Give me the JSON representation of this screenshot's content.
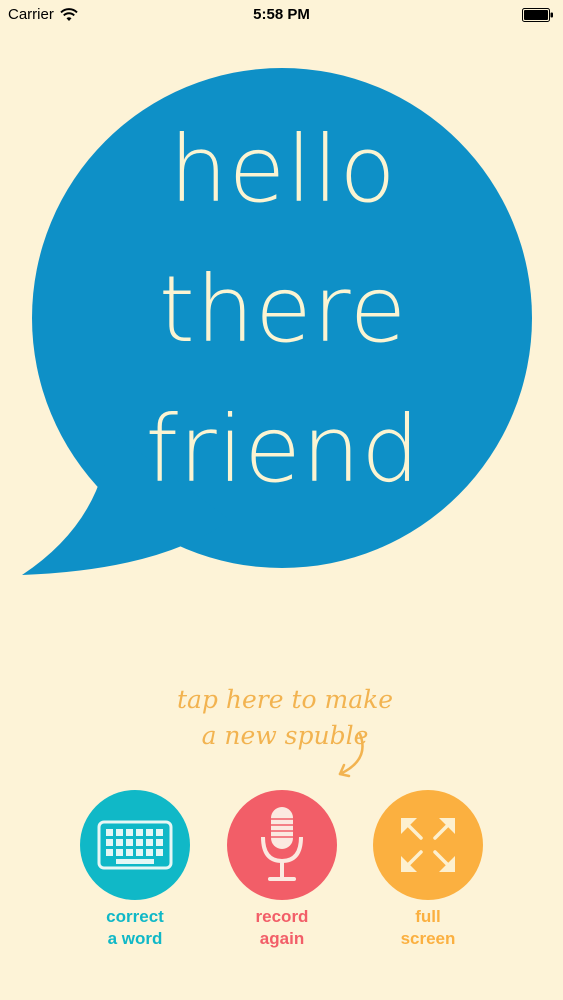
{
  "status_bar": {
    "carrier": "Carrier",
    "time": "5:58 PM",
    "wifi_icon": "wifi-icon",
    "battery_icon": "battery-icon"
  },
  "bubble": {
    "lines": [
      "hello",
      "there",
      "friend"
    ],
    "color": "#0e90c7",
    "text_color": "#fbf4d2"
  },
  "hint": {
    "line1": "tap here to make",
    "line2": "a new spuble",
    "color": "#f2b350",
    "arrow_icon": "curved-arrow-icon"
  },
  "actions": [
    {
      "label_line1": "correct",
      "label_line2": "a word",
      "icon": "keyboard-icon",
      "color": "#10b8c7"
    },
    {
      "label_line1": "record",
      "label_line2": "again",
      "icon": "microphone-icon",
      "color": "#f25e68"
    },
    {
      "label_line1": "full",
      "label_line2": "screen",
      "icon": "fullscreen-icon",
      "color": "#fbb040"
    }
  ],
  "background_color": "#fdf3d7"
}
